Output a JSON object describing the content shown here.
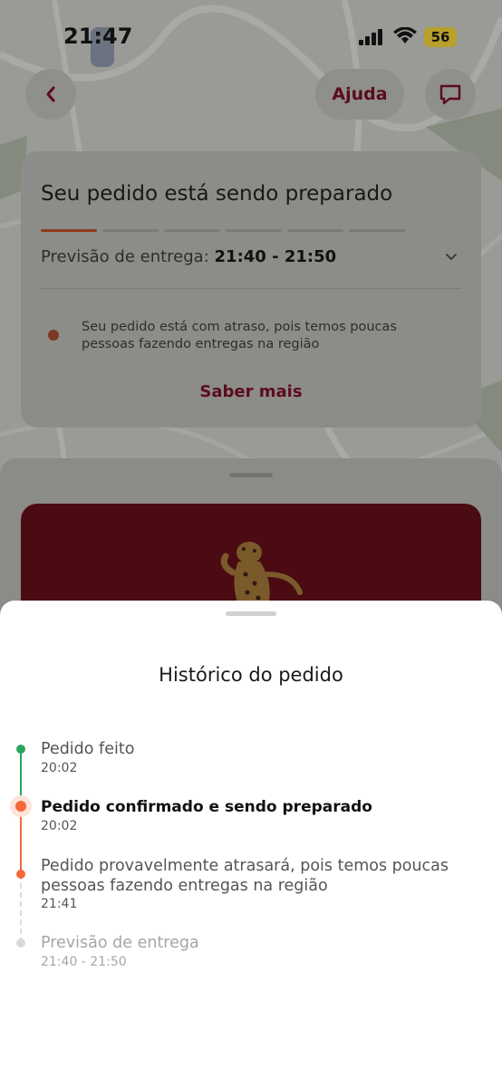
{
  "status_bar": {
    "time": "21:47",
    "battery": "56"
  },
  "header": {
    "help_label": "Ajuda"
  },
  "status_card": {
    "title": "Seu pedido está sendo preparado",
    "progress_segments": 6,
    "progress_active": 1,
    "eta_label": "Previsão de entrega:",
    "eta_value": "21:40 - 21:50",
    "delay_message": "Seu pedido está com atraso, pois temos poucas pessoas fazendo entregas na região",
    "learn_more": "Saber mais"
  },
  "history_sheet": {
    "title": "Histórico do pedido",
    "events": [
      {
        "label": "Pedido feito",
        "time": "20:02",
        "state": "done"
      },
      {
        "label": "Pedido confirmado e sendo preparado",
        "time": "20:02",
        "state": "current"
      },
      {
        "label": "Pedido provavelmente atrasará, pois temos poucas pessoas fazendo entregas na região",
        "time": "21:41",
        "state": "warning"
      },
      {
        "label": "Previsão de entrega",
        "time": "21:40 - 21:50",
        "state": "pending"
      }
    ]
  },
  "colors": {
    "brand": "#EA1D2C",
    "done": "#2AA65B",
    "current": "#F4683A",
    "pending": "#D9D9D9"
  }
}
